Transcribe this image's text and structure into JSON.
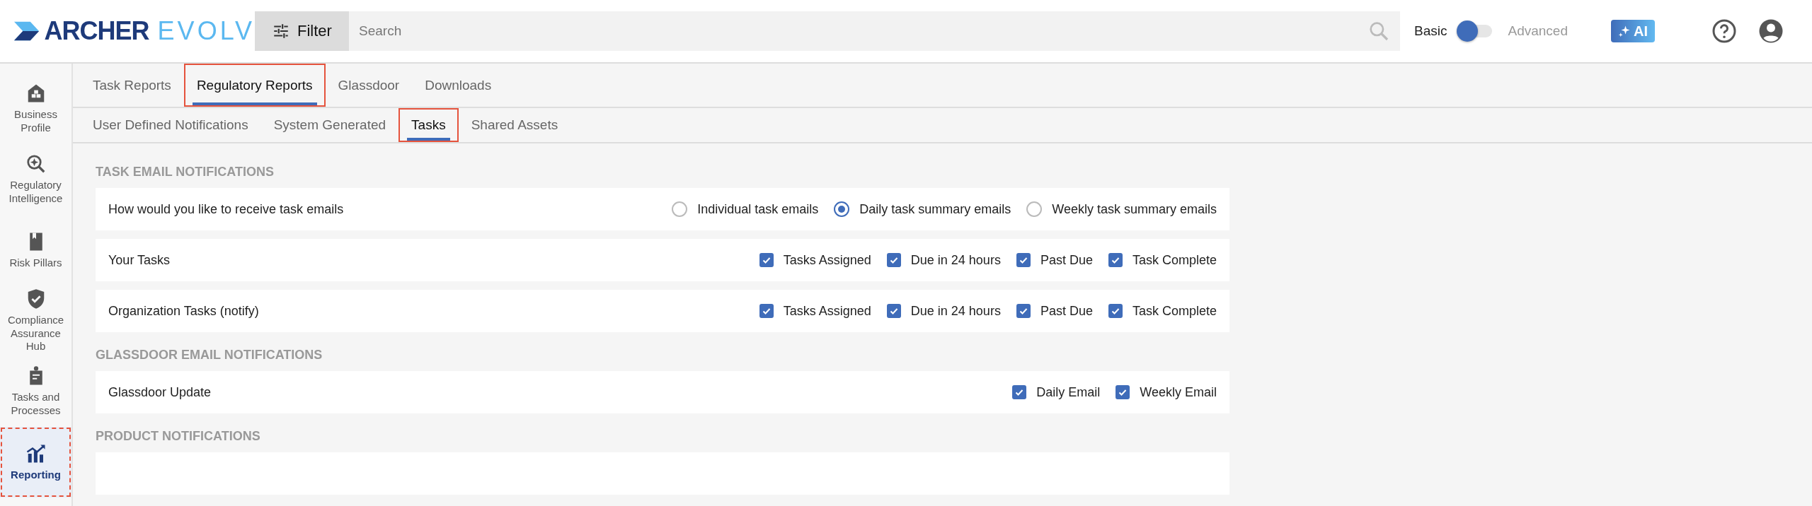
{
  "header": {
    "logo": {
      "brand": "ARCHER",
      "product": "EVOLV"
    },
    "filter_button": "Filter",
    "search": {
      "placeholder": "Search"
    },
    "mode_toggle": {
      "left_label": "Basic",
      "right_label": "Advanced",
      "on": false
    },
    "ai_button": "AI"
  },
  "sidebar": {
    "items": [
      {
        "label": "Business Profile",
        "selected": false,
        "highlighted": false
      },
      {
        "label": "Regulatory Intelligence",
        "selected": false,
        "highlighted": false
      },
      {
        "label": "Risk Pillars",
        "selected": false,
        "highlighted": false
      },
      {
        "label": "Compliance Assurance Hub",
        "selected": false,
        "highlighted": false
      },
      {
        "label": "Tasks and Processes",
        "selected": false,
        "highlighted": false
      },
      {
        "label": "Reporting",
        "selected": true,
        "highlighted": true
      }
    ]
  },
  "tabs": [
    {
      "label": "Task Reports",
      "selected": false,
      "highlighted": false
    },
    {
      "label": "Regulatory Reports",
      "selected": true,
      "highlighted": true
    },
    {
      "label": "Glassdoor",
      "selected": false,
      "highlighted": false
    },
    {
      "label": "Downloads",
      "selected": false,
      "highlighted": false
    }
  ],
  "subtabs": [
    {
      "label": "User Defined Notifications",
      "selected": false,
      "highlighted": false
    },
    {
      "label": "System Generated",
      "selected": false,
      "highlighted": false
    },
    {
      "label": "Tasks",
      "selected": true,
      "highlighted": true
    },
    {
      "label": "Shared Assets",
      "selected": false,
      "highlighted": false
    }
  ],
  "sections": [
    {
      "title": "TASK EMAIL NOTIFICATIONS",
      "rows": [
        {
          "kind": "radio",
          "label": "How would you like to receive task emails",
          "options": [
            {
              "label": "Individual task emails",
              "selected": false
            },
            {
              "label": "Daily task summary emails",
              "selected": true
            },
            {
              "label": "Weekly task summary emails",
              "selected": false
            }
          ]
        },
        {
          "kind": "checkbox",
          "label": "Your Tasks",
          "options": [
            {
              "label": "Tasks Assigned",
              "checked": true
            },
            {
              "label": "Due in 24 hours",
              "checked": true
            },
            {
              "label": "Past Due",
              "checked": true
            },
            {
              "label": "Task Complete",
              "checked": true
            }
          ]
        },
        {
          "kind": "checkbox",
          "label": "Organization Tasks (notify)",
          "options": [
            {
              "label": "Tasks Assigned",
              "checked": true
            },
            {
              "label": "Due in 24 hours",
              "checked": true
            },
            {
              "label": "Past Due",
              "checked": true
            },
            {
              "label": "Task Complete",
              "checked": true
            }
          ]
        }
      ]
    },
    {
      "title": "GLASSDOOR EMAIL NOTIFICATIONS",
      "rows": [
        {
          "kind": "checkbox",
          "label": "Glassdoor Update",
          "options": [
            {
              "label": "Daily Email",
              "checked": true
            },
            {
              "label": "Weekly Email",
              "checked": true
            }
          ]
        }
      ]
    },
    {
      "title": "PRODUCT NOTIFICATIONS",
      "rows": [
        {
          "kind": "blank"
        }
      ]
    }
  ]
}
